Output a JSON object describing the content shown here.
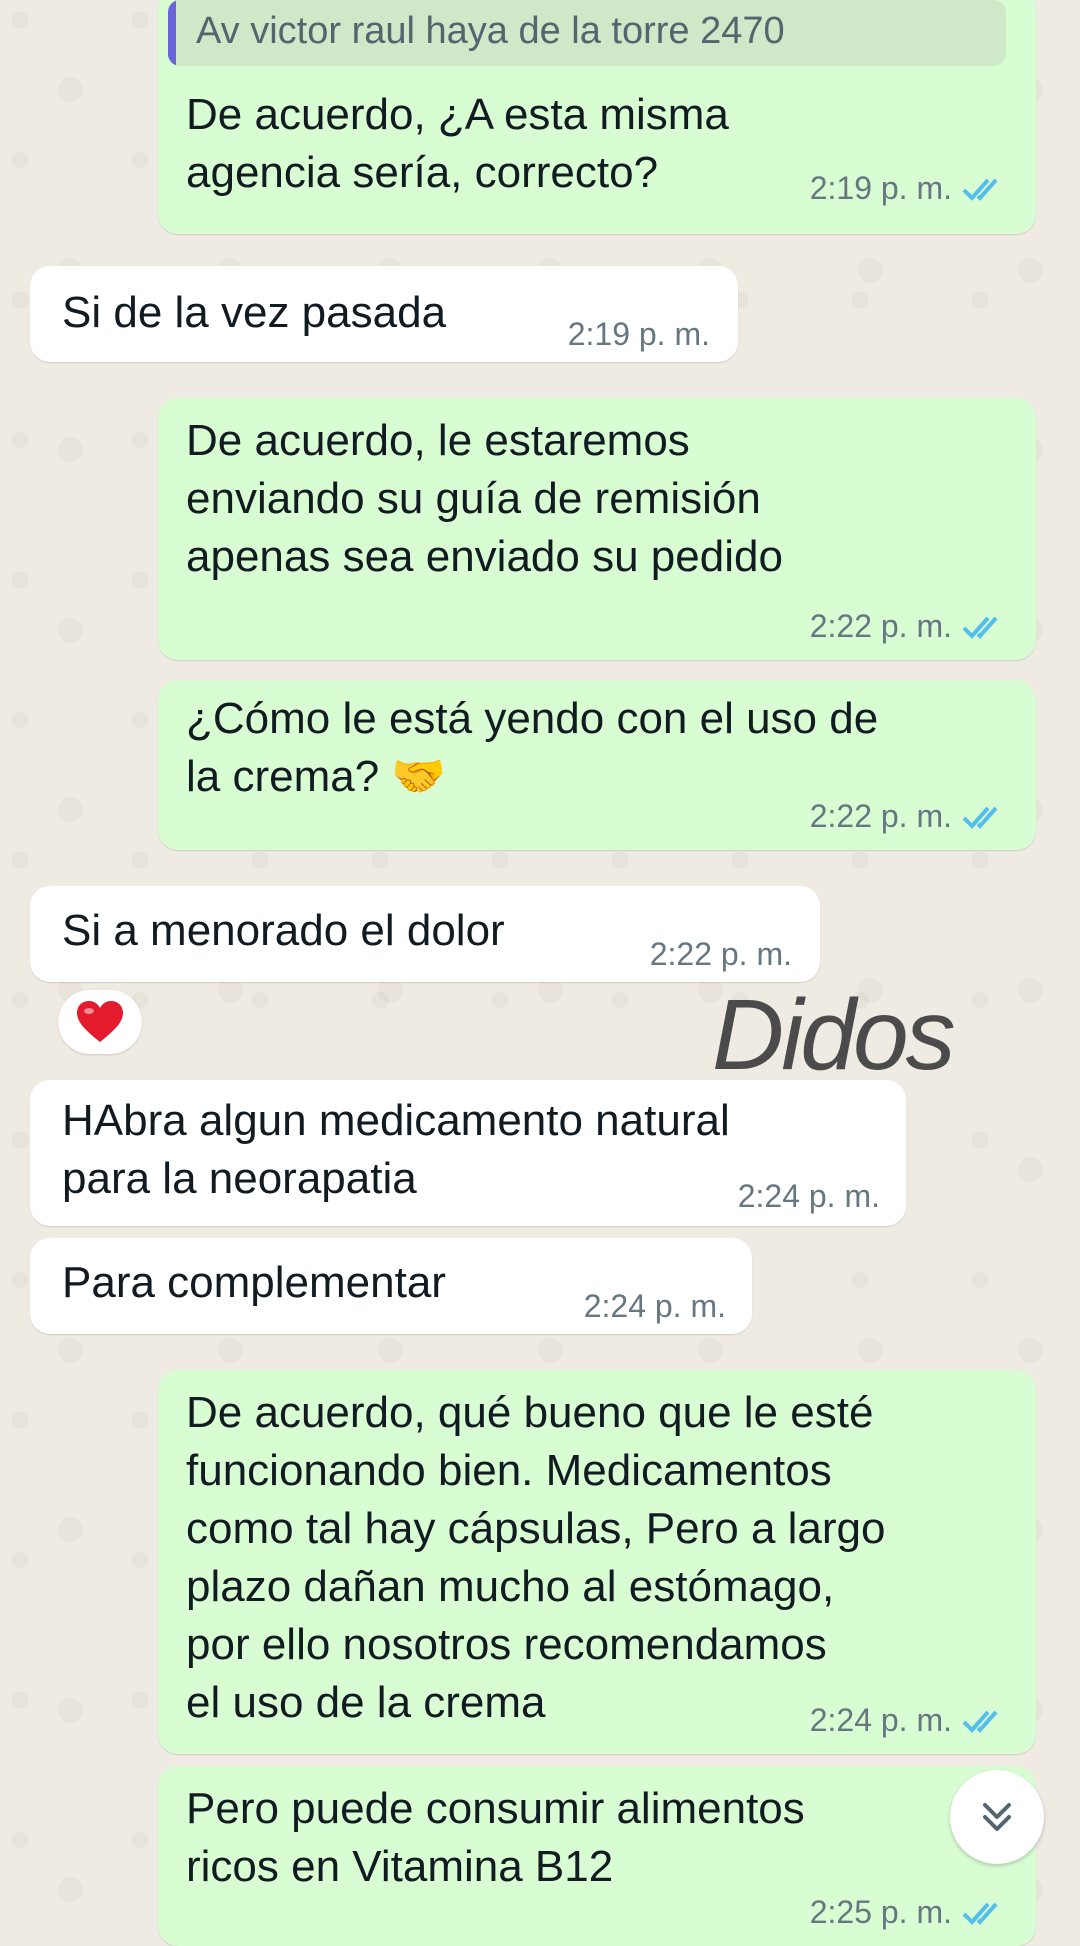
{
  "reply_quote": "Av victor raul haya de la torre 2470",
  "messages": [
    {
      "text": "De acuerdo, ¿A esta misma\nagencia sería, correcto?",
      "time": "2:19 p. m."
    },
    {
      "text": "Si de la vez pasada",
      "time": "2:19 p. m."
    },
    {
      "text": "De acuerdo, le estaremos\nenviando su guía de remisión\napenas sea enviado su pedido",
      "time": "2:22 p. m."
    },
    {
      "text": "¿Cómo le está yendo con el uso de\nla crema? 🤝",
      "time": "2:22 p. m."
    },
    {
      "text": "Si a menorado el dolor",
      "time": "2:22 p. m."
    },
    {
      "text": "HAbra algun medicamento natural\npara la neorapatia",
      "time": "2:24 p. m."
    },
    {
      "text": "Para complementar",
      "time": "2:24 p. m."
    },
    {
      "text": "De acuerdo, qué bueno que le esté\nfuncionando bien. Medicamentos\ncomo tal hay cápsulas, Pero a largo\nplazo dañan mucho al estómago,\npor ello nosotros recomendamos\nel uso de la crema",
      "time": "2:24 p. m."
    },
    {
      "text": "Pero puede consumir alimentos\nricos en Vitamina B12",
      "time": "2:25 p. m."
    }
  ],
  "reaction_emoji": "❤️",
  "watermark": "Didos",
  "icons": {
    "read_ticks": "double-check-icon",
    "scroll_down": "double-chevron-down-icon",
    "reaction": "red-heart-icon"
  },
  "colors": {
    "outgoing_bubble": "#d9fdd3",
    "incoming_bubble": "#ffffff",
    "read_ticks": "#53bdeb",
    "reply_bar": "#6b63d8"
  }
}
